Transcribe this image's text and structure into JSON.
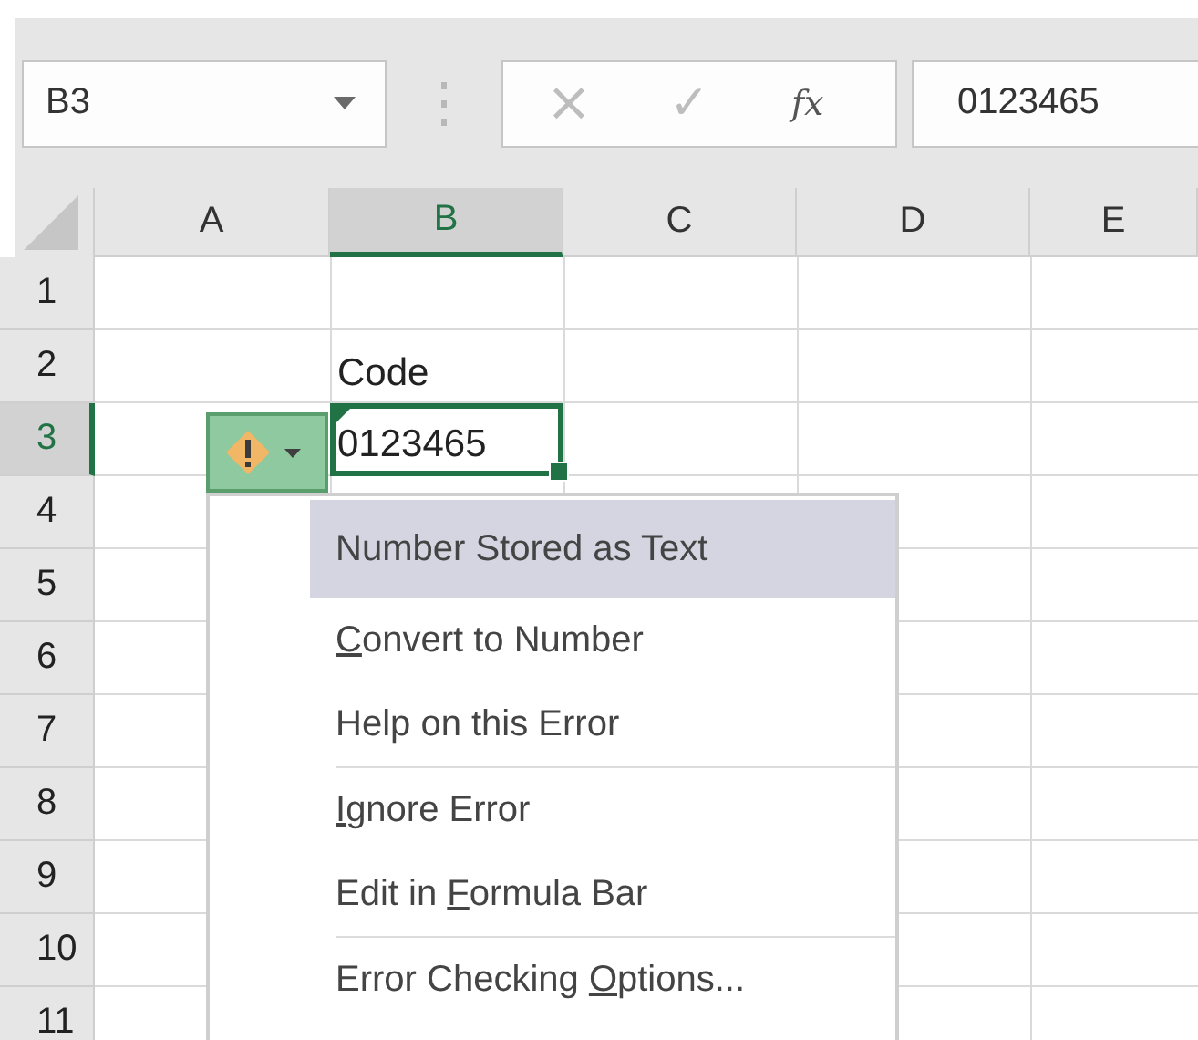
{
  "name_box": {
    "value": "B3"
  },
  "formula_bar": {
    "cancel": "×",
    "enter": "✓",
    "function": "fx",
    "value": "0123465"
  },
  "columns": [
    {
      "label": "A",
      "selected": false
    },
    {
      "label": "B",
      "selected": true
    },
    {
      "label": "C",
      "selected": false
    },
    {
      "label": "D",
      "selected": false
    },
    {
      "label": "E",
      "selected": false
    }
  ],
  "rows": [
    {
      "label": "1",
      "selected": false
    },
    {
      "label": "2",
      "selected": false,
      "cells": [
        null,
        {
          "text": "Code",
          "active": false,
          "error_flag": false
        },
        null,
        null,
        null
      ]
    },
    {
      "label": "3",
      "selected": true,
      "cells": [
        null,
        {
          "text": "0123465",
          "active": true,
          "error_flag": true
        },
        null,
        null,
        null
      ]
    },
    {
      "label": "4",
      "selected": false
    },
    {
      "label": "5",
      "selected": false
    },
    {
      "label": "6",
      "selected": false
    },
    {
      "label": "7",
      "selected": false
    },
    {
      "label": "8",
      "selected": false
    },
    {
      "label": "9",
      "selected": false
    },
    {
      "label": "10",
      "selected": false
    },
    {
      "label": "11",
      "selected": false
    }
  ],
  "smart_tag": {
    "expanded": true
  },
  "menu": [
    {
      "kind": "header",
      "label": {
        "pre": "Number Stored as Text"
      }
    },
    {
      "kind": "item",
      "label": {
        "key": "C",
        "post": "onvert to Number"
      }
    },
    {
      "kind": "item",
      "label": {
        "pre": "Help on this Error"
      }
    },
    {
      "kind": "separator"
    },
    {
      "kind": "item",
      "label": {
        "key": "I",
        "post": "gnore Error"
      }
    },
    {
      "kind": "item",
      "label": {
        "pre": "Edit in ",
        "key": "F",
        "post": "ormula Bar"
      }
    },
    {
      "kind": "separator"
    },
    {
      "kind": "item",
      "label": {
        "pre": "Error Checking ",
        "key": "O",
        "post": "ptions..."
      }
    }
  ]
}
